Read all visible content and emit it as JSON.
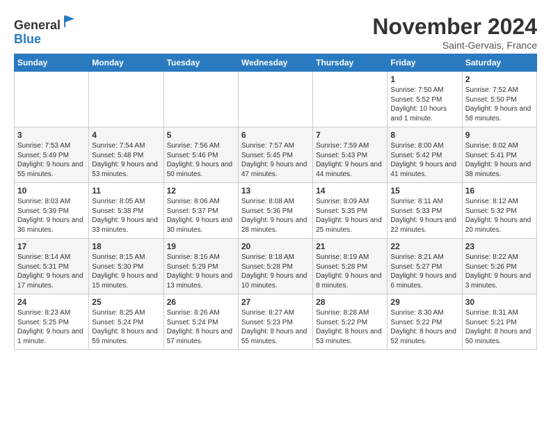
{
  "logo": {
    "general": "General",
    "blue": "Blue"
  },
  "header": {
    "title": "November 2024",
    "location": "Saint-Gervais, France"
  },
  "days_of_week": [
    "Sunday",
    "Monday",
    "Tuesday",
    "Wednesday",
    "Thursday",
    "Friday",
    "Saturday"
  ],
  "weeks": [
    [
      {
        "day": "",
        "info": ""
      },
      {
        "day": "",
        "info": ""
      },
      {
        "day": "",
        "info": ""
      },
      {
        "day": "",
        "info": ""
      },
      {
        "day": "",
        "info": ""
      },
      {
        "day": "1",
        "info": "Sunrise: 7:50 AM\nSunset: 5:52 PM\nDaylight: 10 hours and 1 minute."
      },
      {
        "day": "2",
        "info": "Sunrise: 7:52 AM\nSunset: 5:50 PM\nDaylight: 9 hours and 58 minutes."
      }
    ],
    [
      {
        "day": "3",
        "info": "Sunrise: 7:53 AM\nSunset: 5:49 PM\nDaylight: 9 hours and 55 minutes."
      },
      {
        "day": "4",
        "info": "Sunrise: 7:54 AM\nSunset: 5:48 PM\nDaylight: 9 hours and 53 minutes."
      },
      {
        "day": "5",
        "info": "Sunrise: 7:56 AM\nSunset: 5:46 PM\nDaylight: 9 hours and 50 minutes."
      },
      {
        "day": "6",
        "info": "Sunrise: 7:57 AM\nSunset: 5:45 PM\nDaylight: 9 hours and 47 minutes."
      },
      {
        "day": "7",
        "info": "Sunrise: 7:59 AM\nSunset: 5:43 PM\nDaylight: 9 hours and 44 minutes."
      },
      {
        "day": "8",
        "info": "Sunrise: 8:00 AM\nSunset: 5:42 PM\nDaylight: 9 hours and 41 minutes."
      },
      {
        "day": "9",
        "info": "Sunrise: 8:02 AM\nSunset: 5:41 PM\nDaylight: 9 hours and 38 minutes."
      }
    ],
    [
      {
        "day": "10",
        "info": "Sunrise: 8:03 AM\nSunset: 5:39 PM\nDaylight: 9 hours and 36 minutes."
      },
      {
        "day": "11",
        "info": "Sunrise: 8:05 AM\nSunset: 5:38 PM\nDaylight: 9 hours and 33 minutes."
      },
      {
        "day": "12",
        "info": "Sunrise: 8:06 AM\nSunset: 5:37 PM\nDaylight: 9 hours and 30 minutes."
      },
      {
        "day": "13",
        "info": "Sunrise: 8:08 AM\nSunset: 5:36 PM\nDaylight: 9 hours and 28 minutes."
      },
      {
        "day": "14",
        "info": "Sunrise: 8:09 AM\nSunset: 5:35 PM\nDaylight: 9 hours and 25 minutes."
      },
      {
        "day": "15",
        "info": "Sunrise: 8:11 AM\nSunset: 5:33 PM\nDaylight: 9 hours and 22 minutes."
      },
      {
        "day": "16",
        "info": "Sunrise: 8:12 AM\nSunset: 5:32 PM\nDaylight: 9 hours and 20 minutes."
      }
    ],
    [
      {
        "day": "17",
        "info": "Sunrise: 8:14 AM\nSunset: 5:31 PM\nDaylight: 9 hours and 17 minutes."
      },
      {
        "day": "18",
        "info": "Sunrise: 8:15 AM\nSunset: 5:30 PM\nDaylight: 9 hours and 15 minutes."
      },
      {
        "day": "19",
        "info": "Sunrise: 8:16 AM\nSunset: 5:29 PM\nDaylight: 9 hours and 13 minutes."
      },
      {
        "day": "20",
        "info": "Sunrise: 8:18 AM\nSunset: 5:28 PM\nDaylight: 9 hours and 10 minutes."
      },
      {
        "day": "21",
        "info": "Sunrise: 8:19 AM\nSunset: 5:28 PM\nDaylight: 9 hours and 8 minutes."
      },
      {
        "day": "22",
        "info": "Sunrise: 8:21 AM\nSunset: 5:27 PM\nDaylight: 9 hours and 6 minutes."
      },
      {
        "day": "23",
        "info": "Sunrise: 8:22 AM\nSunset: 5:26 PM\nDaylight: 9 hours and 3 minutes."
      }
    ],
    [
      {
        "day": "24",
        "info": "Sunrise: 8:23 AM\nSunset: 5:25 PM\nDaylight: 9 hours and 1 minute."
      },
      {
        "day": "25",
        "info": "Sunrise: 8:25 AM\nSunset: 5:24 PM\nDaylight: 8 hours and 59 minutes."
      },
      {
        "day": "26",
        "info": "Sunrise: 8:26 AM\nSunset: 5:24 PM\nDaylight: 8 hours and 57 minutes."
      },
      {
        "day": "27",
        "info": "Sunrise: 8:27 AM\nSunset: 5:23 PM\nDaylight: 8 hours and 55 minutes."
      },
      {
        "day": "28",
        "info": "Sunrise: 8:28 AM\nSunset: 5:22 PM\nDaylight: 8 hours and 53 minutes."
      },
      {
        "day": "29",
        "info": "Sunrise: 8:30 AM\nSunset: 5:22 PM\nDaylight: 8 hours and 52 minutes."
      },
      {
        "day": "30",
        "info": "Sunrise: 8:31 AM\nSunset: 5:21 PM\nDaylight: 8 hours and 50 minutes."
      }
    ]
  ]
}
